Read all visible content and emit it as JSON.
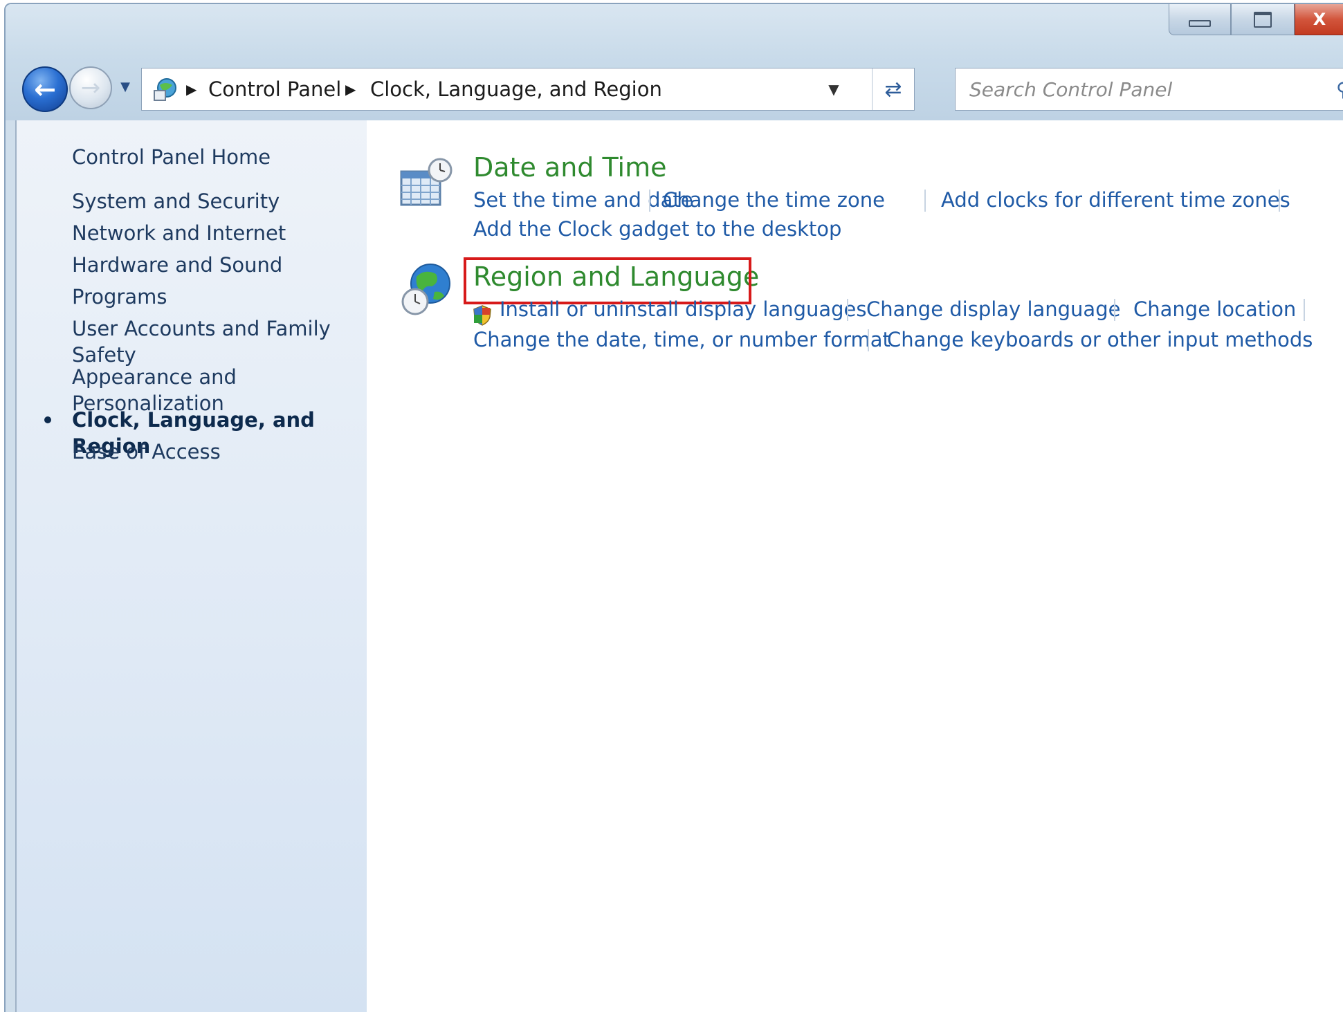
{
  "window": {
    "caption": {
      "minimize": "",
      "maximize": "",
      "close": "X"
    }
  },
  "navigation": {
    "breadcrumb": [
      {
        "label": "Control Panel"
      },
      {
        "label": "Clock, Language, and Region"
      }
    ],
    "search": {
      "placeholder": "Search Control Panel"
    }
  },
  "sidebar": {
    "items": [
      {
        "label": "Control Panel Home",
        "current": false
      },
      {
        "label": "System and Security",
        "current": false
      },
      {
        "label": "Network and Internet",
        "current": false
      },
      {
        "label": "Hardware and Sound",
        "current": false
      },
      {
        "label": "Programs",
        "current": false
      },
      {
        "label": "User Accounts and Family Safety",
        "current": false
      },
      {
        "label": "Appearance and Personalization",
        "current": false
      },
      {
        "label": "Clock, Language, and Region",
        "current": true
      },
      {
        "label": "Ease of Access",
        "current": false
      }
    ]
  },
  "categories": [
    {
      "title": "Date and Time",
      "icon": "calendar-clock-icon",
      "tasks": [
        "Set the time and date",
        "Change the time zone",
        "Add clocks for different time zones",
        "Add the Clock gadget to the desktop"
      ]
    },
    {
      "title": "Region and Language",
      "icon": "globe-clock-icon",
      "highlighted": true,
      "highlight_color": "#d71a1a",
      "tasks": [
        "Install or uninstall display languages",
        "Change display language",
        "Change location",
        "Change the date, time, or number format",
        "Change keyboards or other input methods"
      ]
    }
  ],
  "colors": {
    "category_title": "#2f8a2f",
    "task_link": "#1f5aa6",
    "sidebar_text": "#1e3a5f"
  }
}
